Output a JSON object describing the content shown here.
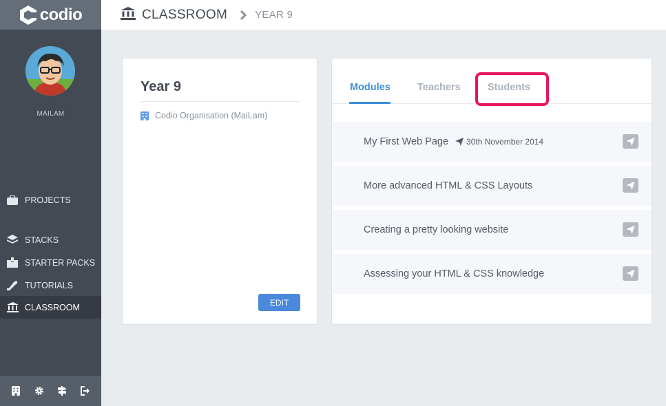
{
  "app": {
    "logo_text": "codio"
  },
  "user": {
    "name": "MAILAM"
  },
  "sidebar": {
    "items": [
      {
        "label": "PROJECTS",
        "icon": "briefcase-icon"
      },
      {
        "label": "STACKS",
        "icon": "layers-icon"
      },
      {
        "label": "STARTER PACKS",
        "icon": "box-icon"
      },
      {
        "label": "TUTORIALS",
        "icon": "tutorial-icon"
      },
      {
        "label": "CLASSROOM",
        "icon": "classroom-icon",
        "active": true
      }
    ],
    "footer_icons": [
      "organisation-icon",
      "gear-icon",
      "signpost-icon",
      "logout-icon"
    ]
  },
  "header": {
    "breadcrumb_root": "CLASSROOM",
    "breadcrumb_leaf": "YEAR 9"
  },
  "class_card": {
    "title": "Year 9",
    "organisation": "Codio Organisation (MaiLam)",
    "edit_label": "EDIT"
  },
  "tabs": [
    {
      "label": "Modules",
      "active": true
    },
    {
      "label": "Teachers"
    },
    {
      "label": "Students",
      "highlighted": true
    }
  ],
  "modules": [
    {
      "title": "My First Web Page",
      "published_date": "30th November 2014"
    },
    {
      "title": "More advanced HTML & CSS Layouts"
    },
    {
      "title": "Creating a pretty looking website"
    },
    {
      "title": "Assessing your HTML & CSS knowledge"
    }
  ],
  "colors": {
    "sidebar_bg": "#434a54",
    "accent": "#3b8fd9",
    "edit_button": "#4a89dc",
    "highlight": "#e8175d"
  }
}
